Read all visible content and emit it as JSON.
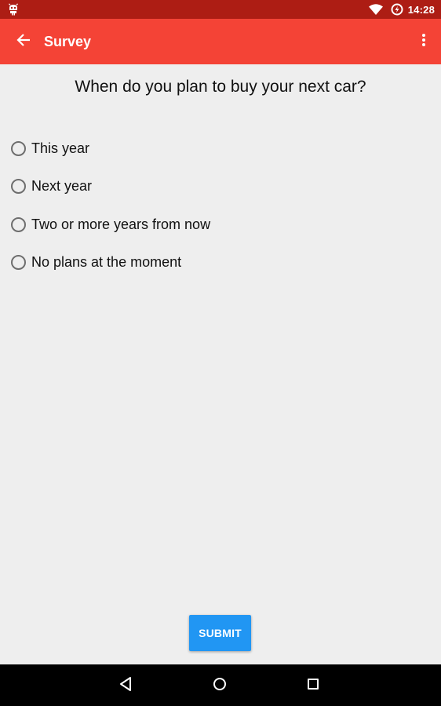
{
  "status_bar": {
    "time": "14:28",
    "icons": [
      "android-notification-icon",
      "wifi-icon",
      "battery-charging-icon"
    ]
  },
  "app_bar": {
    "title": "Survey",
    "icons": [
      "arrow-back-icon",
      "more-vert-icon"
    ],
    "color": "#f44336"
  },
  "survey": {
    "question": "When do you plan to buy your next car?",
    "options": [
      {
        "label": "This year",
        "selected": false
      },
      {
        "label": "Next year",
        "selected": false
      },
      {
        "label": "Two or more years from now",
        "selected": false
      },
      {
        "label": "No plans at the moment",
        "selected": false
      }
    ],
    "submit_label": "SUBMIT",
    "submit_color": "#2196f3"
  },
  "nav_bar": {
    "icons": [
      "back-triangle-icon",
      "home-circle-icon",
      "recents-square-icon"
    ]
  }
}
